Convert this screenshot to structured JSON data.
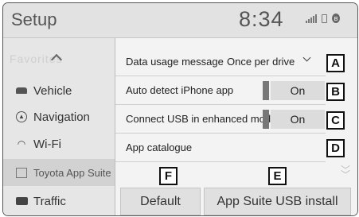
{
  "header": {
    "title": "Setup",
    "clock": "8:34"
  },
  "sidebar": {
    "ghost_text": "Favorites",
    "items": [
      {
        "label": "Vehicle"
      },
      {
        "label": "Navigation"
      },
      {
        "label": "Wi-Fi"
      },
      {
        "label": "Toyota App Suite"
      },
      {
        "label": "Traffic"
      }
    ]
  },
  "settings": {
    "data_usage": {
      "label": "Data usage message",
      "value": "Once per drive"
    },
    "auto_detect": {
      "label": "Auto detect iPhone app",
      "value": "On"
    },
    "connect_usb": {
      "label": "Connect USB in enhanced mode",
      "value": "On"
    },
    "app_catalogue": {
      "label": "App catalogue"
    }
  },
  "buttons": {
    "default": "Default",
    "usb_install": "App Suite USB install"
  },
  "callouts": {
    "a": "A",
    "b": "B",
    "c": "C",
    "d": "D",
    "e": "E",
    "f": "F"
  }
}
